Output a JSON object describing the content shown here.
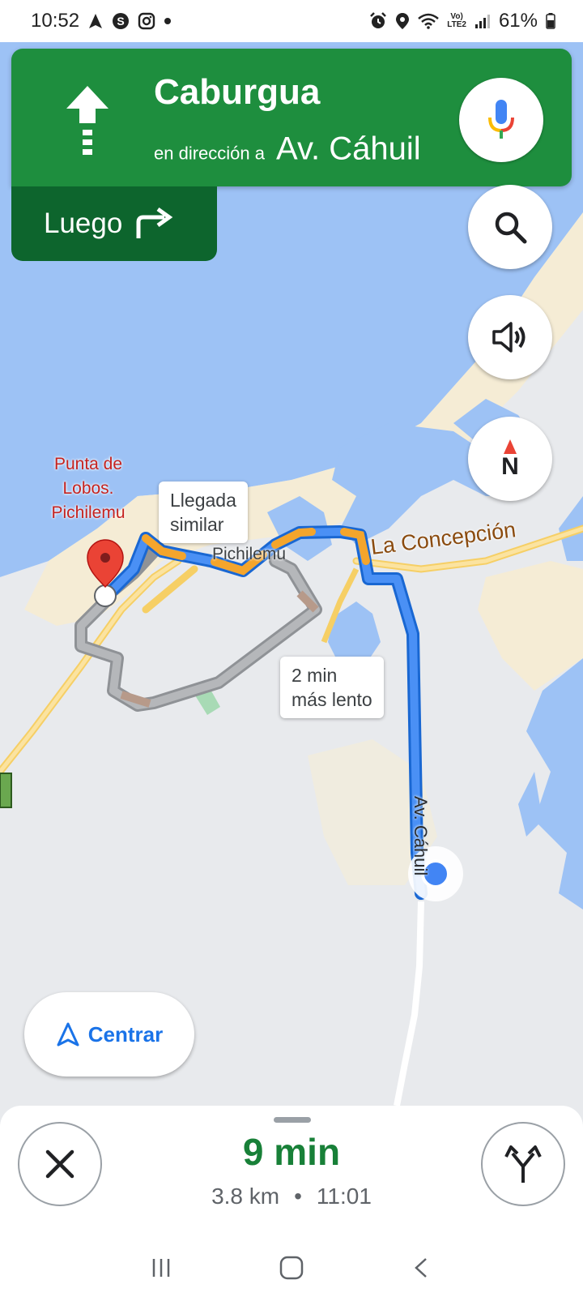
{
  "status_bar": {
    "time": "10:52",
    "battery": "61%",
    "network_top": "Vo)",
    "network_bottom": "LTE2"
  },
  "nav": {
    "street": "Caburgua",
    "towards_prefix": "en dirección a",
    "towards": "Av. Cáhuil",
    "then_label": "Luego",
    "maneuver_icon": "arrow-straight-icon",
    "then_icon": "turn-right-icon"
  },
  "map": {
    "place_label": "Punta de\nLobos.\nPichilemu",
    "place_line1": "Punta de",
    "place_line2": "Lobos.",
    "place_line3": "Pichilemu",
    "town": "Pichilemu",
    "road": "La Concepción",
    "street": "Av. Cáhuil",
    "callout_similar_1": "Llegada",
    "callout_similar_2": "similar",
    "callout_slower_1": "2 min",
    "callout_slower_2": "más lento",
    "compass_letter": "N"
  },
  "buttons": {
    "recenter": "Centrar"
  },
  "trip": {
    "eta_minutes": "9 min",
    "distance": "3.8 km",
    "separator": "•",
    "arrival_time": "11:01"
  },
  "colors": {
    "nav_green": "#1e8e3e",
    "then_green": "#0d652d",
    "route_blue": "#4285f4",
    "alt_gray": "#a8aaad",
    "traffic_orange": "#f4a52c",
    "water": "#9dc2f5",
    "land": "#e8eaed",
    "sand": "#f5ecd5"
  }
}
